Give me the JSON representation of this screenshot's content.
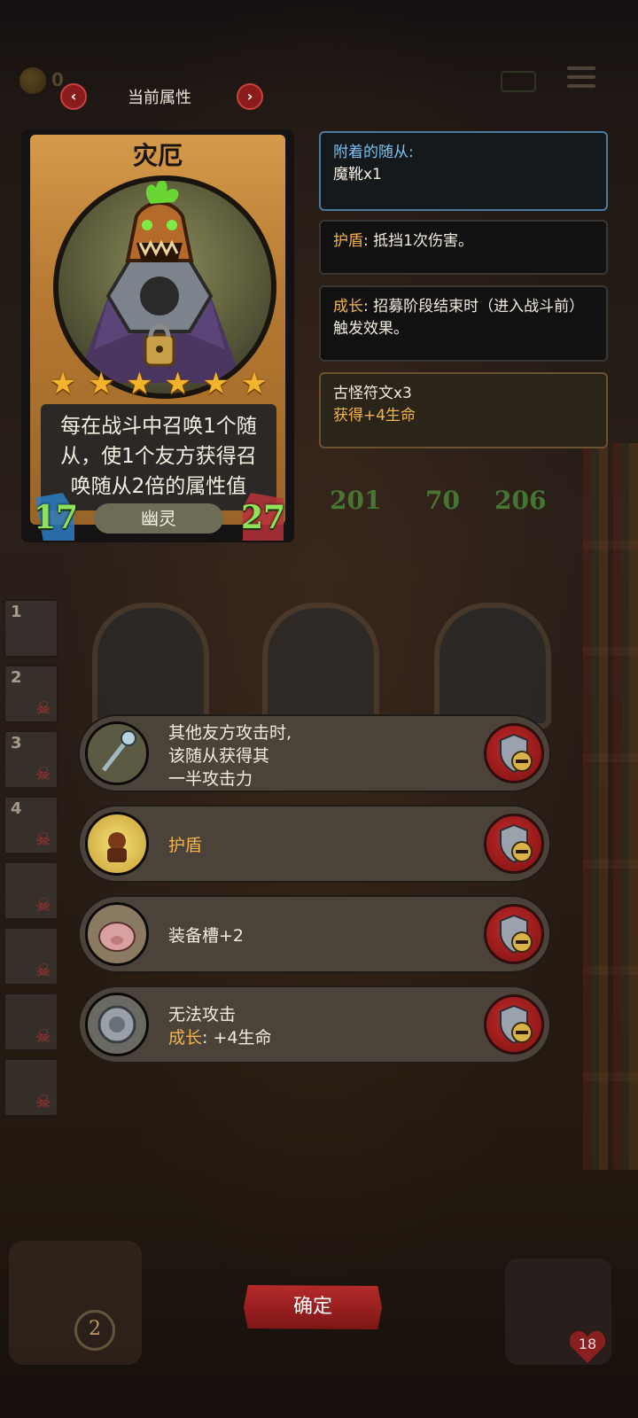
{
  "header": {
    "coins": "0",
    "title": "当前属性",
    "prev_icon": "chevron-left-icon",
    "next_icon": "chevron-right-icon"
  },
  "card": {
    "name": "灾厄",
    "stars": 6,
    "description": "每在战斗中召唤1个随从，使1个友方获得召唤随从2倍的属性值",
    "attack": "17",
    "health": "27",
    "tribe": "幽灵"
  },
  "info": {
    "attached_title": "附着的随从:",
    "attached_value": "魔靴x1",
    "shield_key": "护盾",
    "shield_text": ": 抵挡1次伤害。",
    "growth_key": "成长",
    "growth_text": ": 招募阶段结束时（进入战斗前）触发效果。",
    "rune_title": "古怪符文x3",
    "rune_text": "获得+4生命"
  },
  "board": {
    "numbers": [
      "201",
      "70",
      "206"
    ],
    "slots": [
      "1",
      "2",
      "3",
      "4",
      "",
      "",
      "",
      ""
    ]
  },
  "abilities": [
    {
      "line1": "其他友方攻击时,",
      "line2": "该随从获得其",
      "line3": "一半攻击力"
    },
    {
      "line1": "护盾"
    },
    {
      "line1": "装备槽+2"
    },
    {
      "line1": "无法攻击",
      "line2_key": "成长",
      "line2_rest": ": +4生命"
    }
  ],
  "footer": {
    "confirm": "确定",
    "level": "2",
    "hp": "18"
  },
  "colors": {
    "accent_gold": "#f2b44b",
    "accent_blue": "#7ec3f0",
    "confirm_red": "#b52a2a",
    "stat_green": "#8fe15a"
  }
}
